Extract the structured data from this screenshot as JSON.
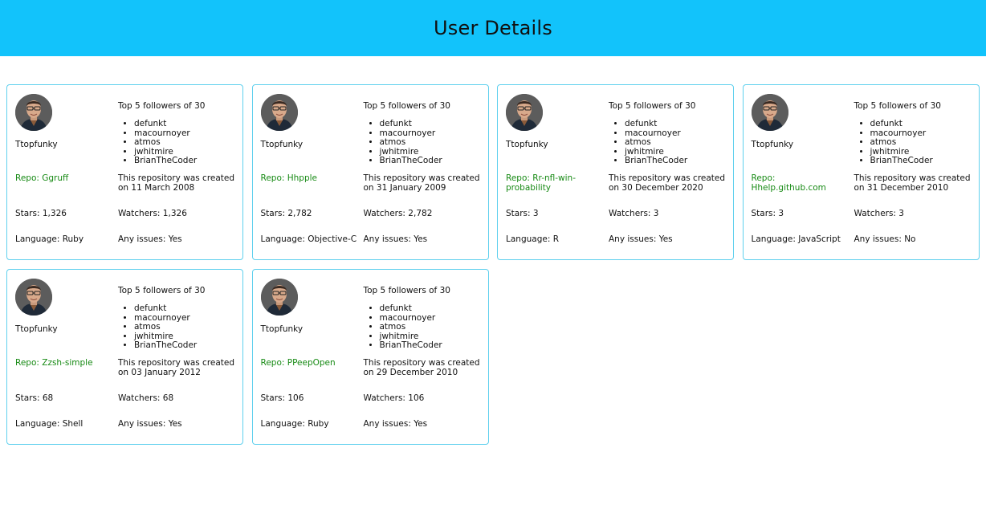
{
  "header": {
    "title": "User Details"
  },
  "colors": {
    "header_bg": "#12c3fb",
    "card_border": "#5fd0ee",
    "repo_link": "#178a14"
  },
  "cards": [
    {
      "username": "Ttopfunky",
      "followers_title": "Top 5 followers of 30",
      "followers": [
        "defunkt",
        "macournoyer",
        "atmos",
        "jwhitmire",
        "BrianTheCoder"
      ],
      "repo": "Repo: Ggruff",
      "created": "This repository was created on 11 March 2008",
      "stars": "Stars: 1,326",
      "watchers": "Watchers: 1,326",
      "language": "Language: Ruby",
      "issues": "Any issues: Yes"
    },
    {
      "username": "Ttopfunky",
      "followers_title": "Top 5 followers of 30",
      "followers": [
        "defunkt",
        "macournoyer",
        "atmos",
        "jwhitmire",
        "BrianTheCoder"
      ],
      "repo": "Repo: Hhpple",
      "created": "This repository was created on 31 January 2009",
      "stars": "Stars: 2,782",
      "watchers": "Watchers: 2,782",
      "language": "Language: Objective-C",
      "issues": "Any issues: Yes"
    },
    {
      "username": "Ttopfunky",
      "followers_title": "Top 5 followers of 30",
      "followers": [
        "defunkt",
        "macournoyer",
        "atmos",
        "jwhitmire",
        "BrianTheCoder"
      ],
      "repo": "Repo: Rr-nfl-win-probability",
      "created": "This repository was created on 30 December 2020",
      "stars": "Stars: 3",
      "watchers": "Watchers: 3",
      "language": "Language: R",
      "issues": "Any issues: Yes"
    },
    {
      "username": "Ttopfunky",
      "followers_title": "Top 5 followers of 30",
      "followers": [
        "defunkt",
        "macournoyer",
        "atmos",
        "jwhitmire",
        "BrianTheCoder"
      ],
      "repo": "Repo: Hhelp.github.com",
      "created": "This repository was created on 31 December 2010",
      "stars": "Stars: 3",
      "watchers": "Watchers: 3",
      "language": "Language: JavaScript",
      "issues": "Any issues: No"
    },
    {
      "username": "Ttopfunky",
      "followers_title": "Top 5 followers of 30",
      "followers": [
        "defunkt",
        "macournoyer",
        "atmos",
        "jwhitmire",
        "BrianTheCoder"
      ],
      "repo": "Repo: Zzsh-simple",
      "created": "This repository was created on 03 January 2012",
      "stars": "Stars: 68",
      "watchers": "Watchers: 68",
      "language": "Language: Shell",
      "issues": "Any issues: Yes"
    },
    {
      "username": "Ttopfunky",
      "followers_title": "Top 5 followers of 30",
      "followers": [
        "defunkt",
        "macournoyer",
        "atmos",
        "jwhitmire",
        "BrianTheCoder"
      ],
      "repo": "Repo: PPeepOpen",
      "created": "This repository was created on 29 December 2010",
      "stars": "Stars: 106",
      "watchers": "Watchers: 106",
      "language": "Language: Ruby",
      "issues": "Any issues: Yes"
    }
  ]
}
